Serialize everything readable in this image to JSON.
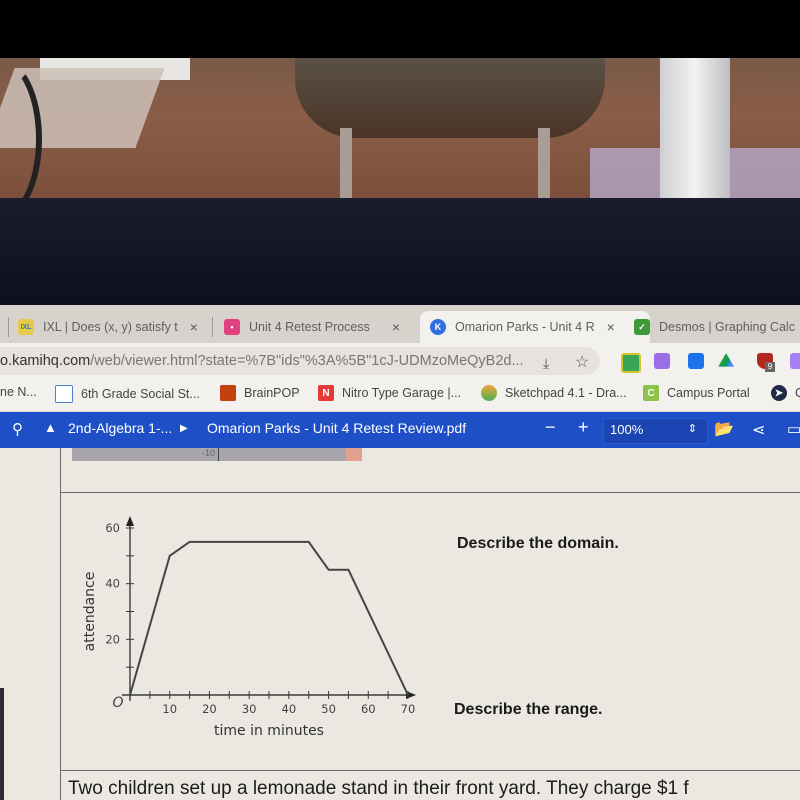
{
  "browser": {
    "tabs": [
      {
        "label": "IXL | Does (x, y) satisfy t",
        "icon": "ixl-favicon",
        "icon_text": "IXL",
        "active": false
      },
      {
        "label": "Unit 4 Retest Process",
        "icon": "google-classroom-assignment-favicon",
        "active": false
      },
      {
        "label": "Omarion Parks - Unit 4 R",
        "icon": "kami-favicon",
        "icon_text": "K",
        "active": true
      },
      {
        "label": "Desmos | Graphing Calc",
        "icon": "desmos-favicon",
        "active": false
      }
    ],
    "tab_close_glyph": "×",
    "url": {
      "host": "o.kamihq.com",
      "path": "/web/viewer.html?state=%7B\"ids\"%3A%5B\"1cJ-UDMzoMeQyB2d..."
    },
    "extension_badge": "9",
    "bookmarks": [
      {
        "label": "ne N...",
        "icon": "bookmark-icon"
      },
      {
        "label": "6th Grade Social St...",
        "icon": "google-sheets-icon"
      },
      {
        "label": "BrainPOP",
        "icon": "brainpop-icon"
      },
      {
        "label": "Nitro Type Garage |...",
        "icon": "nitro-type-icon",
        "icon_text": "N"
      },
      {
        "label": "Sketchpad 4.1 - Dra...",
        "icon": "sketchpad-icon"
      },
      {
        "label": "Campus Portal",
        "icon": "campus-portal-icon",
        "icon_text": "C"
      },
      {
        "label": "C",
        "icon": "paper-plane-icon"
      }
    ]
  },
  "kami": {
    "folder": "2nd-Algebra 1-...",
    "file": "Omarion Parks - Unit 4 Retest Review.pdf",
    "zoom_out": "−",
    "zoom_in": "+",
    "zoom_level": "100%",
    "zoom_spinner": "⇕"
  },
  "document": {
    "prev_graph_tick": "-10",
    "prompt_domain": "Describe the domain.",
    "prompt_range": "Describe the range.",
    "next_question": "Two children set up a lemonade stand in their front yard. They charge $1 f"
  },
  "chart_data": {
    "type": "line",
    "title": "",
    "xlabel": "time in minutes",
    "ylabel": "attendance",
    "origin_label": "O",
    "xlim": [
      0,
      70
    ],
    "ylim": [
      0,
      60
    ],
    "x_ticks": [
      10,
      20,
      30,
      40,
      50,
      60,
      70
    ],
    "y_ticks": [
      20,
      40,
      60
    ],
    "x_minor_step": 5,
    "y_minor_step": 10,
    "grid": false,
    "series": [
      {
        "name": "attendance",
        "x": [
          0,
          10,
          15,
          45,
          50,
          55,
          70
        ],
        "y": [
          0,
          50,
          55,
          55,
          45,
          45,
          0
        ]
      }
    ]
  }
}
